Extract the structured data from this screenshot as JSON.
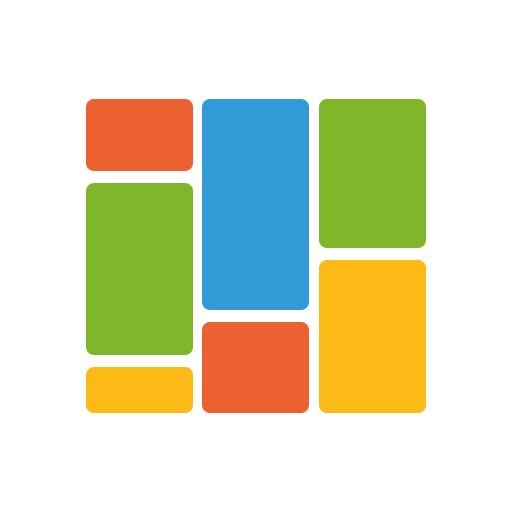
{
  "tiles": [
    {
      "id": "col1-top",
      "color": "#EB6130"
    },
    {
      "id": "col1-middle",
      "color": "#80B72A"
    },
    {
      "id": "col1-bottom",
      "color": "#FBBA16"
    },
    {
      "id": "col2-top",
      "color": "#329BD7"
    },
    {
      "id": "col2-bottom",
      "color": "#EB6130"
    },
    {
      "id": "col3-top",
      "color": "#80B72A"
    },
    {
      "id": "col3-bottom",
      "color": "#FBBA16"
    }
  ],
  "icon": "colored-tiles-grid-icon"
}
